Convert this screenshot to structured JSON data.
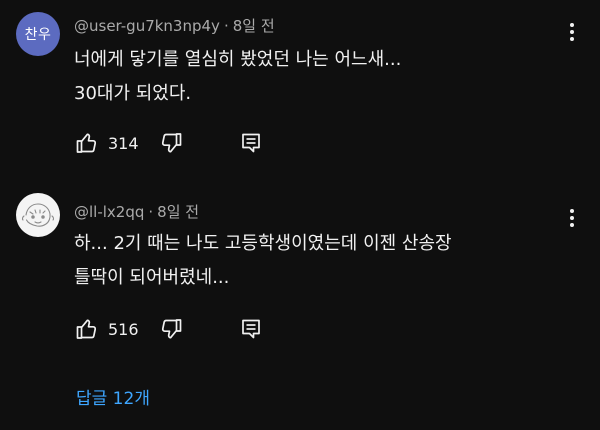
{
  "comments": [
    {
      "avatar_text": "찬우",
      "avatar_color": "#5c6bc0",
      "author": "@user-gu7kn3np4y",
      "time": "8일 전",
      "lines": [
        "너에게 닿기를 열심히 봤었던 나는 어느새...",
        "30대가 되었다."
      ],
      "likes": "314"
    },
    {
      "avatar_icon": "doodle-face-icon",
      "author": "@ll-lx2qq",
      "time": "8일 전",
      "lines": [
        "하... 2기 때는 나도 고등학생이였는데 이젠 산송장",
        "틀딱이 되어버렸네..."
      ],
      "likes": "516"
    }
  ],
  "meta_separator": "·",
  "replies_label": "답글 12개",
  "colors": {
    "background": "#0f0f0f",
    "text": "#f1f1f1",
    "meta": "#aaaaaa",
    "link": "#3ea6ff"
  },
  "icons": {
    "like": "thumbs-up-icon",
    "dislike": "thumbs-down-icon",
    "reply": "reply-comment-icon",
    "menu": "more-vertical-icon"
  }
}
